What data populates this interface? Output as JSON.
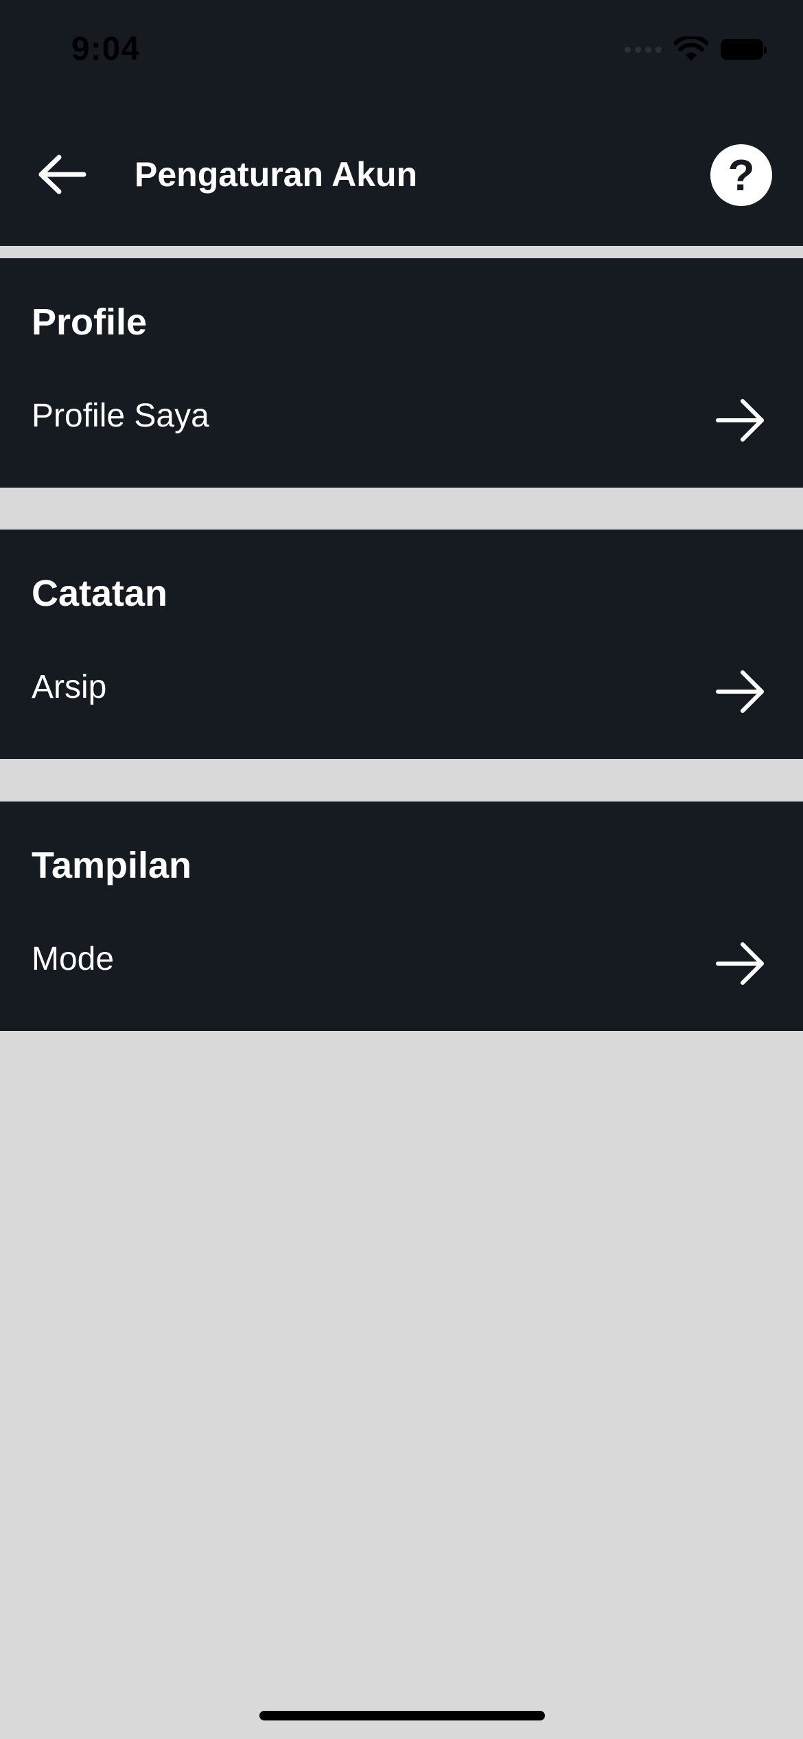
{
  "status_bar": {
    "time": "9:04"
  },
  "header": {
    "title": "Pengaturan Akun",
    "back_icon": "arrow-left-icon",
    "help_label": "?"
  },
  "sections": [
    {
      "title": "Profile",
      "item_label": "Profile Saya",
      "item_icon": "arrow-right-icon"
    },
    {
      "title": "Catatan",
      "item_label": "Arsip",
      "item_icon": "arrow-right-icon"
    },
    {
      "title": "Tampilan",
      "item_label": "Mode",
      "item_icon": "arrow-right-icon"
    }
  ],
  "colors": {
    "surface": "#161a21",
    "background": "#d9d9d9",
    "text": "#ffffff"
  }
}
